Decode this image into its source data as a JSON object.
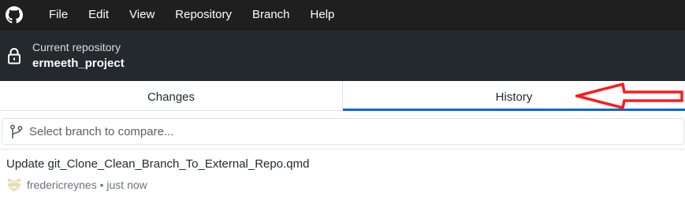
{
  "menubar": {
    "app_icon": "github-octocat-icon",
    "items": [
      {
        "label": "File"
      },
      {
        "label": "Edit"
      },
      {
        "label": "View"
      },
      {
        "label": "Repository"
      },
      {
        "label": "Branch"
      },
      {
        "label": "Help"
      }
    ]
  },
  "repository": {
    "label": "Current repository",
    "name": "ermeeth_project",
    "icon": "lock-icon"
  },
  "tabs": [
    {
      "label": "Changes",
      "selected": false
    },
    {
      "label": "History",
      "selected": true
    }
  ],
  "compare": {
    "icon": "git-branch-icon",
    "placeholder": "Select branch to compare...",
    "value": ""
  },
  "commits": [
    {
      "summary": "Update git_Clone_Clean_Branch_To_External_Repo.qmd",
      "author": "fredericreynes",
      "separator": "•",
      "time": "just now"
    }
  ],
  "colors": {
    "menubar_bg": "#1f1f1f",
    "toolbar_bg": "#24292e",
    "tab_selected_underline": "#0366d6",
    "annotation_arrow": "#ff0000"
  }
}
